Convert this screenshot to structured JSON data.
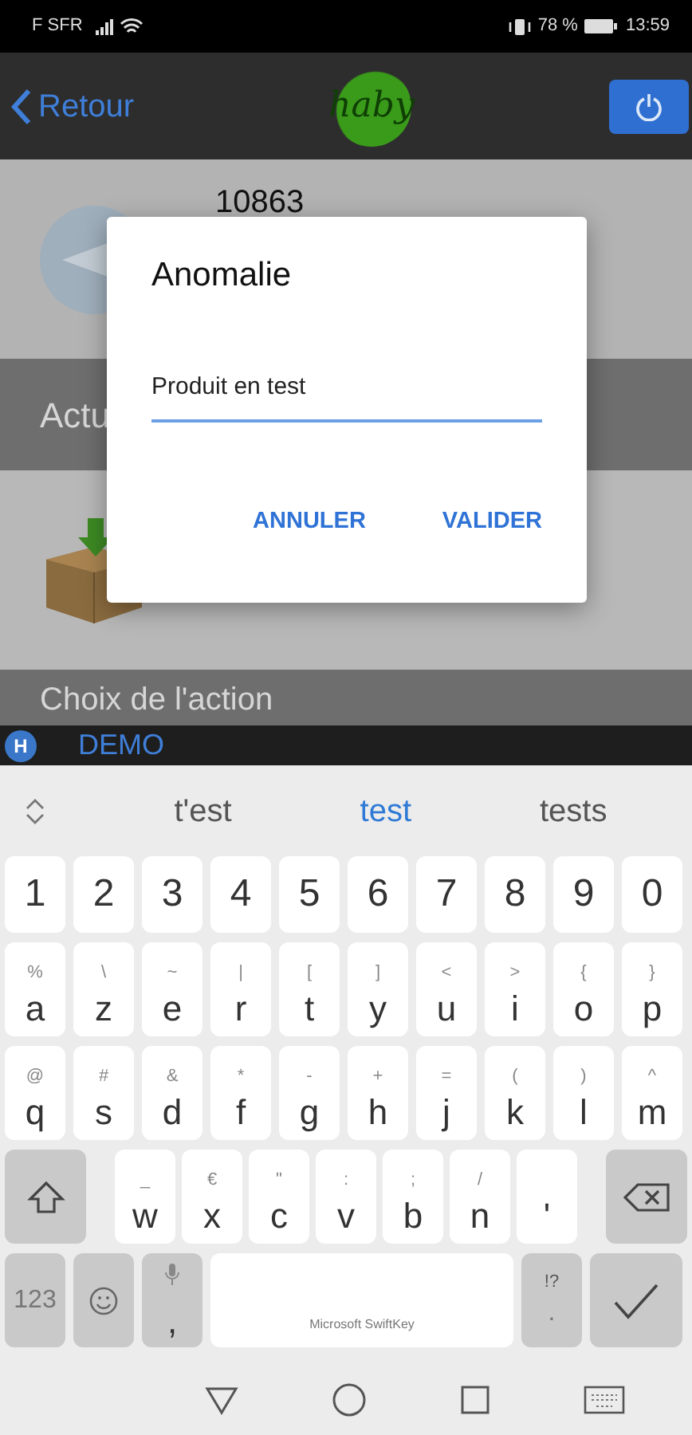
{
  "status_bar": {
    "carrier": "F SFR",
    "battery": "78 %",
    "time": "13:59"
  },
  "header": {
    "back": "Retour",
    "logo": "haby"
  },
  "background": {
    "item_number": "10863",
    "section_1": "Actu",
    "section_2": "Choix de l'action"
  },
  "dialog": {
    "title": "Anomalie",
    "value": "Produit en test",
    "buttons": [
      "ANNULER",
      "VALIDER"
    ]
  },
  "demo_bar": {
    "badge": "H",
    "label": "DEMO"
  },
  "keyboard": {
    "suggestions": [
      {
        "text": "t'est",
        "selected": false
      },
      {
        "text": "test",
        "selected": true
      },
      {
        "text": "tests",
        "selected": false
      }
    ],
    "rows": [
      {
        "keys": [
          {
            "kind": "char",
            "main": "1"
          },
          {
            "kind": "char",
            "main": "2"
          },
          {
            "kind": "char",
            "main": "3"
          },
          {
            "kind": "char",
            "main": "4"
          },
          {
            "kind": "char",
            "main": "5"
          },
          {
            "kind": "char",
            "main": "6"
          },
          {
            "kind": "char",
            "main": "7"
          },
          {
            "kind": "char",
            "main": "8"
          },
          {
            "kind": "char",
            "main": "9"
          },
          {
            "kind": "char",
            "main": "0"
          }
        ]
      },
      {
        "keys": [
          {
            "kind": "char",
            "main": "a",
            "alt": "%"
          },
          {
            "kind": "char",
            "main": "z",
            "alt": "\\"
          },
          {
            "kind": "char",
            "main": "e",
            "alt": "~"
          },
          {
            "kind": "char",
            "main": "r",
            "alt": "|"
          },
          {
            "kind": "char",
            "main": "t",
            "alt": "["
          },
          {
            "kind": "char",
            "main": "y",
            "alt": "]"
          },
          {
            "kind": "char",
            "main": "u",
            "alt": "<"
          },
          {
            "kind": "char",
            "main": "i",
            "alt": ">"
          },
          {
            "kind": "char",
            "main": "o",
            "alt": "{"
          },
          {
            "kind": "char",
            "main": "p",
            "alt": "}"
          }
        ]
      },
      {
        "keys": [
          {
            "kind": "char",
            "main": "q",
            "alt": "@"
          },
          {
            "kind": "char",
            "main": "s",
            "alt": "#"
          },
          {
            "kind": "char",
            "main": "d",
            "alt": "&"
          },
          {
            "kind": "char",
            "main": "f",
            "alt": "*"
          },
          {
            "kind": "char",
            "main": "g",
            "alt": "-"
          },
          {
            "kind": "char",
            "main": "h",
            "alt": "+"
          },
          {
            "kind": "char",
            "main": "j",
            "alt": "="
          },
          {
            "kind": "char",
            "main": "k",
            "alt": "("
          },
          {
            "kind": "char",
            "main": "l",
            "alt": ")"
          },
          {
            "kind": "char",
            "main": "m",
            "alt": "^"
          }
        ]
      },
      {
        "keys": [
          {
            "kind": "shift"
          },
          {
            "kind": "char",
            "main": "w",
            "alt": "_"
          },
          {
            "kind": "char",
            "main": "x",
            "alt": "€"
          },
          {
            "kind": "char",
            "main": "c",
            "alt": "\""
          },
          {
            "kind": "char",
            "main": "v",
            "alt": ":"
          },
          {
            "kind": "char",
            "main": "b",
            "alt": ";"
          },
          {
            "kind": "char",
            "main": "n",
            "alt": "/"
          },
          {
            "kind": "char",
            "main": "'"
          },
          {
            "kind": "backspace"
          }
        ]
      },
      {
        "keys": [
          {
            "kind": "func",
            "main": "123"
          },
          {
            "kind": "emoji"
          },
          {
            "kind": "mic",
            "main": ","
          },
          {
            "kind": "space",
            "main": "Microsoft SwiftKey"
          },
          {
            "kind": "func",
            "main": ".",
            "alt": "!?"
          },
          {
            "kind": "enter"
          }
        ]
      }
    ]
  }
}
